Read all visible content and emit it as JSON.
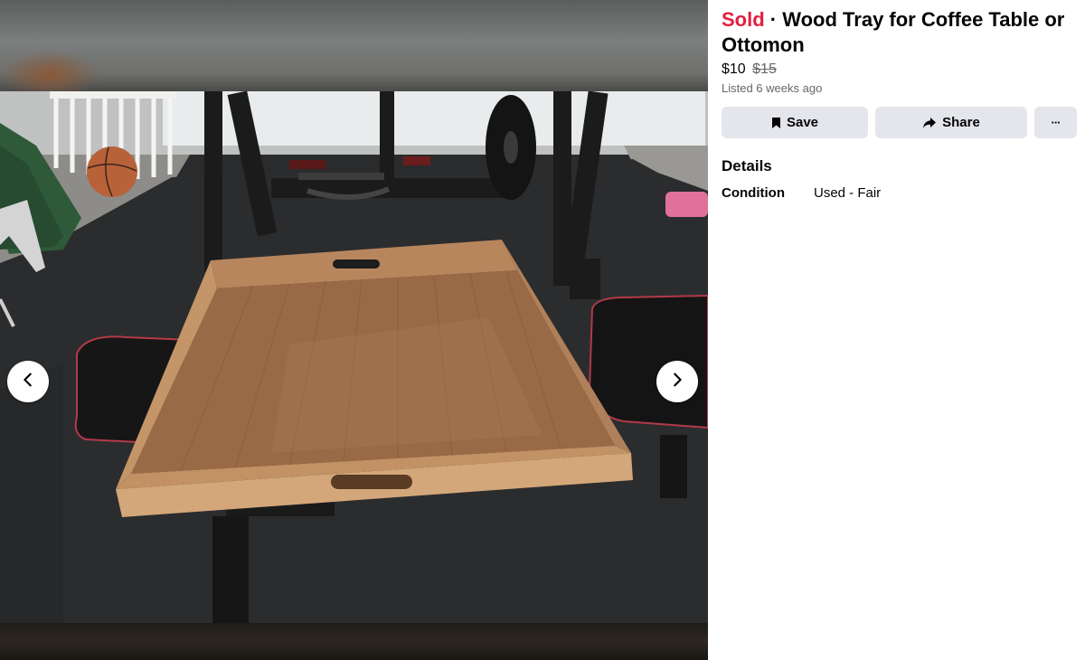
{
  "listing": {
    "status": "Sold",
    "separator": "·",
    "title": "Wood Tray for Coffee Table or Ottomon",
    "price": "$10",
    "original_price": "$15",
    "listed": "Listed 6 weeks ago"
  },
  "actions": {
    "save_label": "Save",
    "share_label": "Share",
    "more_label": "···"
  },
  "details": {
    "heading": "Details",
    "condition_label": "Condition",
    "condition_value": "Used - Fair"
  },
  "icons": {
    "prev": "chevron-left-icon",
    "next": "chevron-right-icon",
    "save": "bookmark-icon",
    "share": "share-arrow-icon",
    "more": "more-horizontal-icon"
  },
  "colors": {
    "sold": "#e41e3f",
    "button_bg": "#e4e6eb",
    "secondary_text": "#65676b"
  }
}
